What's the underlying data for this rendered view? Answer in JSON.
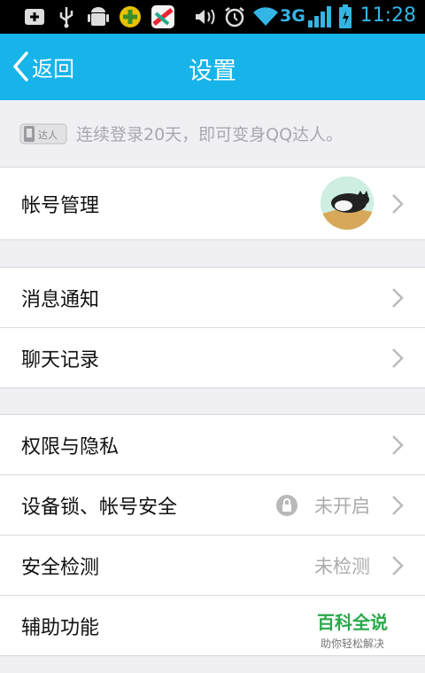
{
  "status_bar": {
    "network": "3G",
    "time": "11:28",
    "icons": [
      "notification-plus-icon",
      "usb-icon",
      "android-debug-icon",
      "app-icon",
      "app-icon",
      "vibrate-icon",
      "alarm-icon",
      "wifi-icon",
      "signal-icon",
      "battery-icon"
    ]
  },
  "nav": {
    "back_label": "返回",
    "title": "设置"
  },
  "notice": {
    "badge_text": "达人",
    "text": "连续登录20天，即可变身QQ达人。"
  },
  "sections": {
    "account": {
      "label": "帐号管理"
    },
    "messages": {
      "label": "消息通知"
    },
    "chat_history": {
      "label": "聊天记录"
    },
    "privacy": {
      "label": "权限与隐私"
    },
    "device_lock": {
      "label": "设备锁、帐号安全",
      "value": "未开启"
    },
    "security_check": {
      "label": "安全检测",
      "value": "未检测"
    },
    "accessibility": {
      "label": "辅助功能"
    }
  },
  "watermark": {
    "main": "百科全说",
    "sub": "助你轻松解决"
  },
  "colors": {
    "nav_bg": "#16b4e9",
    "page_bg": "#efeff4",
    "status_accent": "#33b5e5",
    "watermark_green": "#2aa84a"
  }
}
